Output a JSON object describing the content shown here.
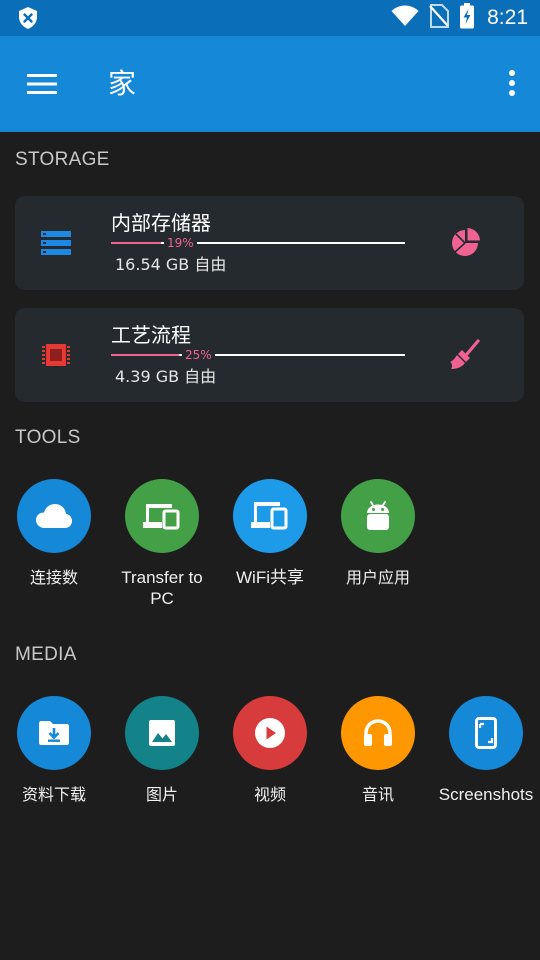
{
  "status_bar": {
    "time": "8:21",
    "icons": [
      "shield-x-icon",
      "wifi-icon",
      "no-sim-icon",
      "battery-charging-icon"
    ]
  },
  "app_bar": {
    "title": "家",
    "menu_icon": "hamburger-menu-icon",
    "more_icon": "more-vert-icon"
  },
  "storage": {
    "header": "STORAGE",
    "items": [
      {
        "name": "内部存储器",
        "percent_label": "19%",
        "percent": 19,
        "free": "16.54 GB 自由",
        "icon": "storage-list-icon",
        "action_icon": "pie-chart-icon"
      },
      {
        "name": "工艺流程",
        "percent_label": "25%",
        "percent": 25,
        "free": "4.39 GB 自由",
        "icon": "memory-chip-icon",
        "action_icon": "broom-icon"
      }
    ]
  },
  "tools": {
    "header": "TOOLS",
    "items": [
      {
        "label": "连接数",
        "icon": "cloud-icon",
        "color": "#1588d8"
      },
      {
        "label": "Transfer to PC",
        "icon": "devices-icon",
        "color": "#43a047"
      },
      {
        "label": "WiFi共享",
        "icon": "devices-icon",
        "color": "#1e9be8"
      },
      {
        "label": "用户应用",
        "icon": "android-icon",
        "color": "#43a047"
      }
    ]
  },
  "media": {
    "header": "MEDIA",
    "items": [
      {
        "label": "资料下载",
        "icon": "download-folder-icon",
        "color": "#1588d8"
      },
      {
        "label": "图片",
        "icon": "image-icon",
        "color": "#138389"
      },
      {
        "label": "视频",
        "icon": "play-circle-icon",
        "color": "#d83b3b"
      },
      {
        "label": "音讯",
        "icon": "headphones-icon",
        "color": "#ff9800"
      },
      {
        "label": "Screenshots",
        "icon": "screenshot-icon",
        "color": "#1588d8"
      }
    ]
  }
}
